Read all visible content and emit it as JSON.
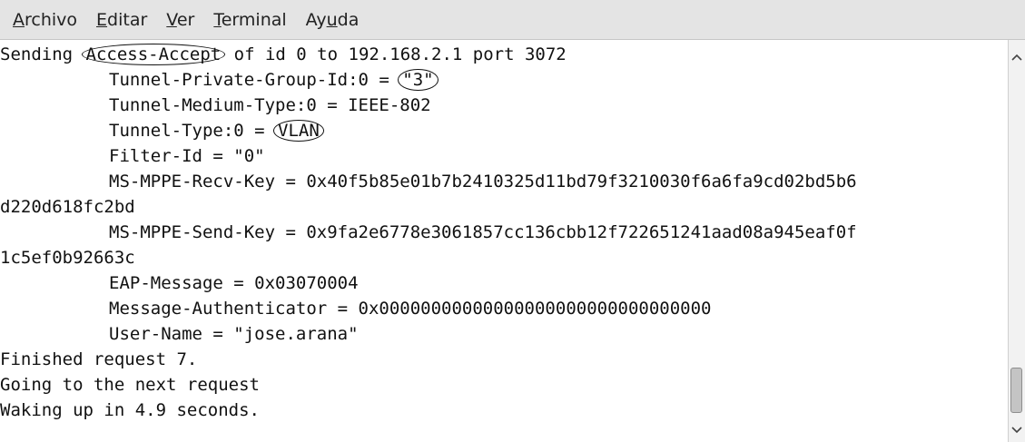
{
  "menubar": {
    "items": [
      {
        "mnemonic": "A",
        "rest": "rchivo"
      },
      {
        "mnemonic": "E",
        "rest": "ditar"
      },
      {
        "mnemonic": "V",
        "rest": "er"
      },
      {
        "mnemonic": "T",
        "rest": "erminal"
      },
      {
        "before": "Ay",
        "mnemonic": "u",
        "rest": "da"
      }
    ]
  },
  "terminal": {
    "line1": {
      "pre": "Sending ",
      "circled": "Access-Accept",
      "post": " of id 0 to 192.168.2.1 port 3072"
    },
    "line2": {
      "pre": "Tunnel-Private-Group-Id:0 = ",
      "circled": "\"3\""
    },
    "line3": "Tunnel-Medium-Type:0 = IEEE-802",
    "line4": {
      "pre": "Tunnel-Type:0 = ",
      "circled": "VLAN"
    },
    "line5": "Filter-Id = \"0\"",
    "line6": "MS-MPPE-Recv-Key = 0x40f5b85e01b7b2410325d11bd79f3210030f6a6fa9cd02bd5b6",
    "line7": "d220d618fc2bd",
    "line8": "MS-MPPE-Send-Key = 0x9fa2e6778e3061857cc136cbb12f722651241aad08a945eaf0f",
    "line9": "1c5ef0b92663c",
    "line10": "EAP-Message = 0x03070004",
    "line11": "Message-Authenticator = 0x00000000000000000000000000000000",
    "line12": "User-Name = \"jose.arana\"",
    "line13": "Finished request 7.",
    "line14": "Going to the next request",
    "line15": "Waking up in 4.9 seconds."
  },
  "scrollbar": {
    "up_icon": "chevron-up-icon",
    "down_icon": "chevron-down-icon"
  }
}
